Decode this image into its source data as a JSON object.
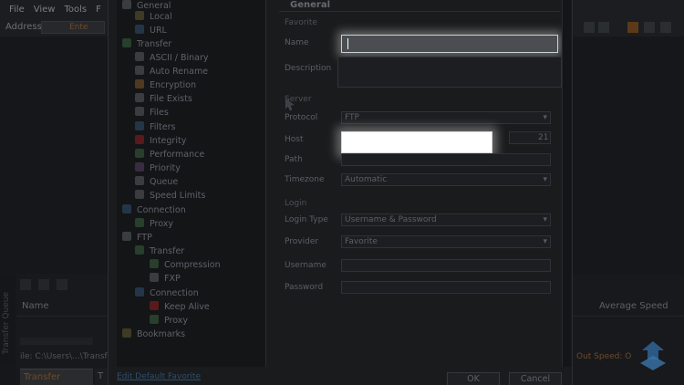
{
  "app": {
    "menu": [
      "File",
      "View",
      "Tools",
      "F"
    ],
    "address_label": "Address",
    "address_value": "Ente",
    "bottom": {
      "side_tab": "Transfer Queue",
      "column_name": "Name",
      "column_speed": "Average Speed",
      "file_path": "ile:   C:\\Users\\...\\Transf",
      "out_speed": "Out Speed: O",
      "tab_transfer_queue": "Transfer Queue",
      "tab_second": "T"
    }
  },
  "dialog": {
    "tree": [
      {
        "label": "General",
        "icon": "gear-icon"
      },
      {
        "label": "Local",
        "icon": "folder-icon"
      },
      {
        "label": "URL",
        "icon": "url-icon"
      },
      {
        "label": "Transfer",
        "icon": "transfer-icon"
      },
      {
        "label": "ASCII / Binary",
        "icon": "ascii-icon"
      },
      {
        "label": "Auto Rename",
        "icon": "rename-icon"
      },
      {
        "label": "Encryption",
        "icon": "lock-icon"
      },
      {
        "label": "File Exists",
        "icon": "file-exists-icon"
      },
      {
        "label": "Files",
        "icon": "files-icon"
      },
      {
        "label": "Filters",
        "icon": "filter-icon"
      },
      {
        "label": "Integrity",
        "icon": "integrity-icon"
      },
      {
        "label": "Performance",
        "icon": "performance-icon"
      },
      {
        "label": "Priority",
        "icon": "priority-icon"
      },
      {
        "label": "Queue",
        "icon": "queue-icon"
      },
      {
        "label": "Speed Limits",
        "icon": "speed-icon"
      },
      {
        "label": "Connection",
        "icon": "connection-icon"
      },
      {
        "label": "Proxy",
        "icon": "proxy-icon"
      },
      {
        "label": "FTP",
        "icon": "ftp-icon"
      },
      {
        "label": "Transfer",
        "icon": "transfer-icon"
      },
      {
        "label": "Compression",
        "icon": "compression-icon"
      },
      {
        "label": "FXP",
        "icon": "fxp-icon"
      },
      {
        "label": "Connection",
        "icon": "connection-icon"
      },
      {
        "label": "Keep Alive",
        "icon": "heart-icon"
      },
      {
        "label": "Proxy",
        "icon": "proxy-icon"
      },
      {
        "label": "Bookmarks",
        "icon": "bookmark-icon"
      }
    ],
    "section_title": "General",
    "groups": {
      "favorite": "Favorite",
      "server": "Server",
      "login": "Login"
    },
    "labels": {
      "name": "Name",
      "description": "Description",
      "protocol": "Protocol",
      "host": "Host",
      "path": "Path",
      "timezone": "Timezone",
      "login_type": "Login Type",
      "provider": "Provider",
      "username": "Username",
      "password": "Password"
    },
    "values": {
      "name": "",
      "host": "",
      "port": "21",
      "protocol": "FTP",
      "timezone": "Automatic",
      "login_type": "Username & Password",
      "provider": "Favorite"
    },
    "bottom_link": "Edit Default Favorite",
    "buttons": {
      "ok": "OK",
      "cancel": "Cancel"
    }
  }
}
